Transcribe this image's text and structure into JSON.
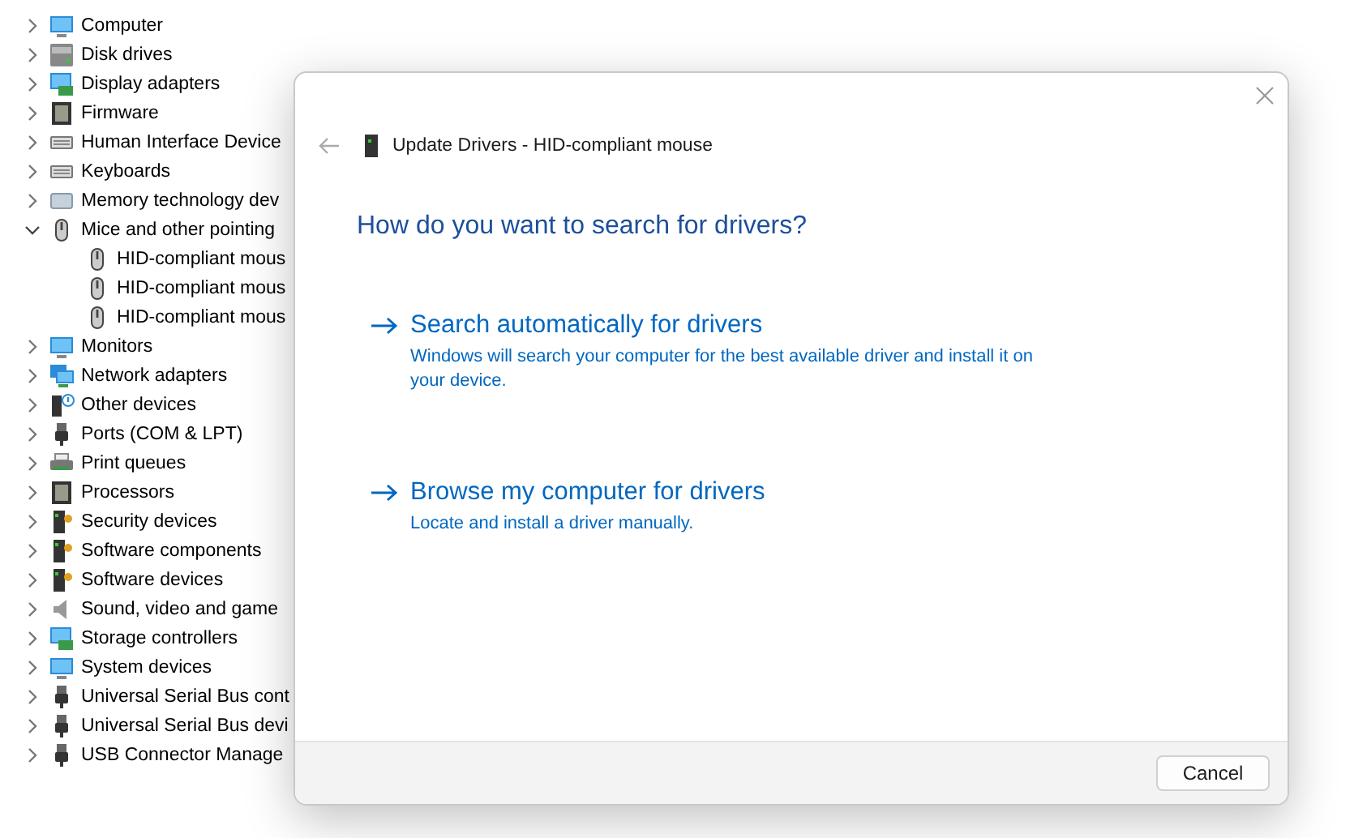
{
  "device_tree": [
    {
      "label": "Computer",
      "kind": "monitor",
      "expanded": false
    },
    {
      "label": "Disk drives",
      "kind": "drive",
      "expanded": false
    },
    {
      "label": "Display adapters",
      "kind": "adapter",
      "expanded": false
    },
    {
      "label": "Firmware",
      "kind": "chip",
      "expanded": false
    },
    {
      "label": "Human Interface Device",
      "kind": "keyboard",
      "expanded": false
    },
    {
      "label": "Keyboards",
      "kind": "keyboard",
      "expanded": false
    },
    {
      "label": "Memory technology dev",
      "kind": "card",
      "expanded": false
    },
    {
      "label": "Mice and other pointing",
      "kind": "mouse",
      "expanded": true,
      "children": [
        {
          "label": "HID-compliant mous",
          "kind": "mouse"
        },
        {
          "label": "HID-compliant mous",
          "kind": "mouse"
        },
        {
          "label": "HID-compliant mous",
          "kind": "mouse"
        }
      ]
    },
    {
      "label": "Monitors",
      "kind": "monitor",
      "expanded": false
    },
    {
      "label": "Network adapters",
      "kind": "network",
      "expanded": false
    },
    {
      "label": "Other devices",
      "kind": "unknown",
      "expanded": false
    },
    {
      "label": "Ports (COM & LPT)",
      "kind": "port",
      "expanded": false
    },
    {
      "label": "Print queues",
      "kind": "printer",
      "expanded": false
    },
    {
      "label": "Processors",
      "kind": "chip",
      "expanded": false
    },
    {
      "label": "Security devices",
      "kind": "tower",
      "expanded": false
    },
    {
      "label": "Software components",
      "kind": "tower",
      "expanded": false
    },
    {
      "label": "Software devices",
      "kind": "tower",
      "expanded": false
    },
    {
      "label": "Sound, video and game",
      "kind": "speaker",
      "expanded": false
    },
    {
      "label": "Storage controllers",
      "kind": "adapter",
      "expanded": false
    },
    {
      "label": "System devices",
      "kind": "monitor",
      "expanded": false
    },
    {
      "label": "Universal Serial Bus cont",
      "kind": "port",
      "expanded": false
    },
    {
      "label": "Universal Serial Bus devi",
      "kind": "port",
      "expanded": false
    },
    {
      "label": "USB Connector Manage",
      "kind": "port",
      "expanded": false
    }
  ],
  "dialog": {
    "title": "Update Drivers - HID-compliant mouse",
    "heading": "How do you want to search for drivers?",
    "options": [
      {
        "title": "Search automatically for drivers",
        "description": "Windows will search your computer for the best available driver and install it on your device."
      },
      {
        "title": "Browse my computer for drivers",
        "description": "Locate and install a driver manually."
      }
    ],
    "buttons": [
      "Cancel"
    ]
  }
}
